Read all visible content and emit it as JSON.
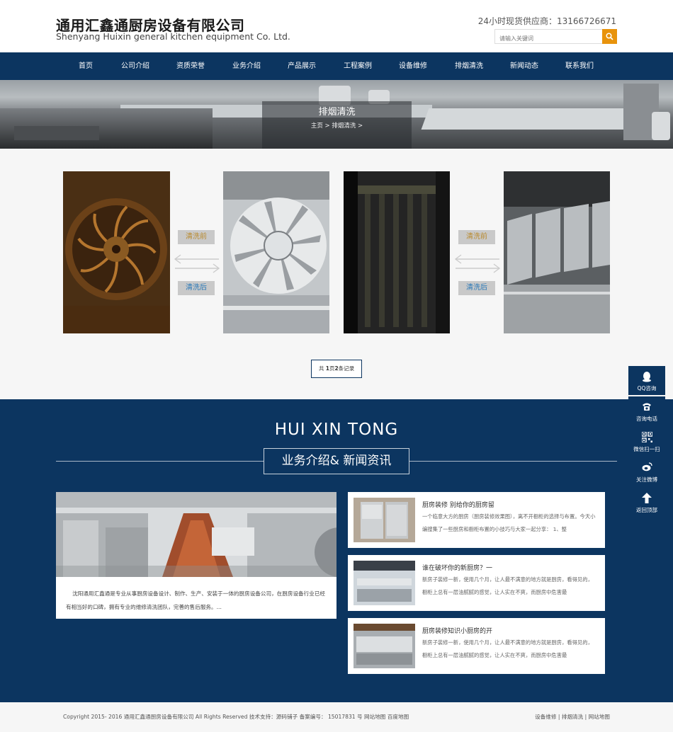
{
  "header": {
    "company_cn": "通用汇鑫通厨房设备有限公司",
    "company_en": "Shenyang Huixin general kitchen equipment Co. Ltd.",
    "hotline": "24小时现货供应商：13166726671",
    "search_placeholder": "请输入关键词",
    "search_icon": "search-icon",
    "accent_color": "#e8930c"
  },
  "nav": {
    "bg_color": "#0c3560",
    "items": [
      "首页",
      "公司介绍",
      "资质荣誉",
      "业务介绍",
      "产品展示",
      "工程案例",
      "设备维修",
      "排烟清洗",
      "新闻动态",
      "联系我们"
    ]
  },
  "banner": {
    "title": "排烟清洗",
    "breadcrumb": "主页   >   排烟清洗   >"
  },
  "gallery": {
    "pairs": [
      {
        "before_label": "清洗前",
        "after_label": "清洗后"
      },
      {
        "before_label": "清洗前",
        "after_label": "清洗后"
      }
    ],
    "pager": {
      "prefix": "共 ",
      "pages": "1",
      "mid": "页",
      "records": "2",
      "suffix": "条记录"
    }
  },
  "section": {
    "title_en": "HUI XIN TONG",
    "title_cn": "业务介绍& 新闻资讯",
    "feature_text": "沈阳通用汇鑫通是专业从事厨房设备设计、制作、生产、安装于一体的厨房设备公司，在厨房设备行业已经有相当好的口碑，拥有专业的维修清洗团队，完善的售后服务。...",
    "news": [
      {
        "title": "厨房装修 别给你的厨房留",
        "desc": "一个临意大方的厨房（厨房装修效果图），离不开橱柜的选择与布置。今天小编搜集了一些厨房和橱柜布置的小技巧与大家一起分享： 1、整"
      },
      {
        "title": "谁在破坏你的新厨房？一",
        "desc": "新房子装修一新，使用几个月，让人最不满意的地方就是厨房，看得见的，橱柜上总有一层油腻腻的感觉，让人实在不爽，而厨房中危害最"
      },
      {
        "title": "厨房装修知识小厨房的开",
        "desc": "新房子装修一新，使用几个月，让人最不满意的地方就是厨房，看得见的，橱柜上总有一层油腻腻的感觉，让人实在不爽，而厨房中危害最"
      }
    ]
  },
  "sidebar": {
    "items": [
      {
        "label": "QQ咨询",
        "icon": "qq-icon"
      },
      {
        "label": "咨询电话",
        "icon": "phone-icon"
      },
      {
        "label": "微信扫一扫",
        "icon": "qrcode-icon"
      },
      {
        "label": "关注微博",
        "icon": "weibo-icon"
      },
      {
        "label": "返回顶部",
        "icon": "arrow-up-icon"
      }
    ]
  },
  "footer": {
    "copyright": "Copyright 2015- 2016 通用汇鑫通厨房设备有限公司 All Rights Reserved 技术支持：源码铺子 备案编号： 15017831 号  网站地图  百度地图",
    "links": "设备维修 | 排烟清洗 | 网站地图"
  }
}
